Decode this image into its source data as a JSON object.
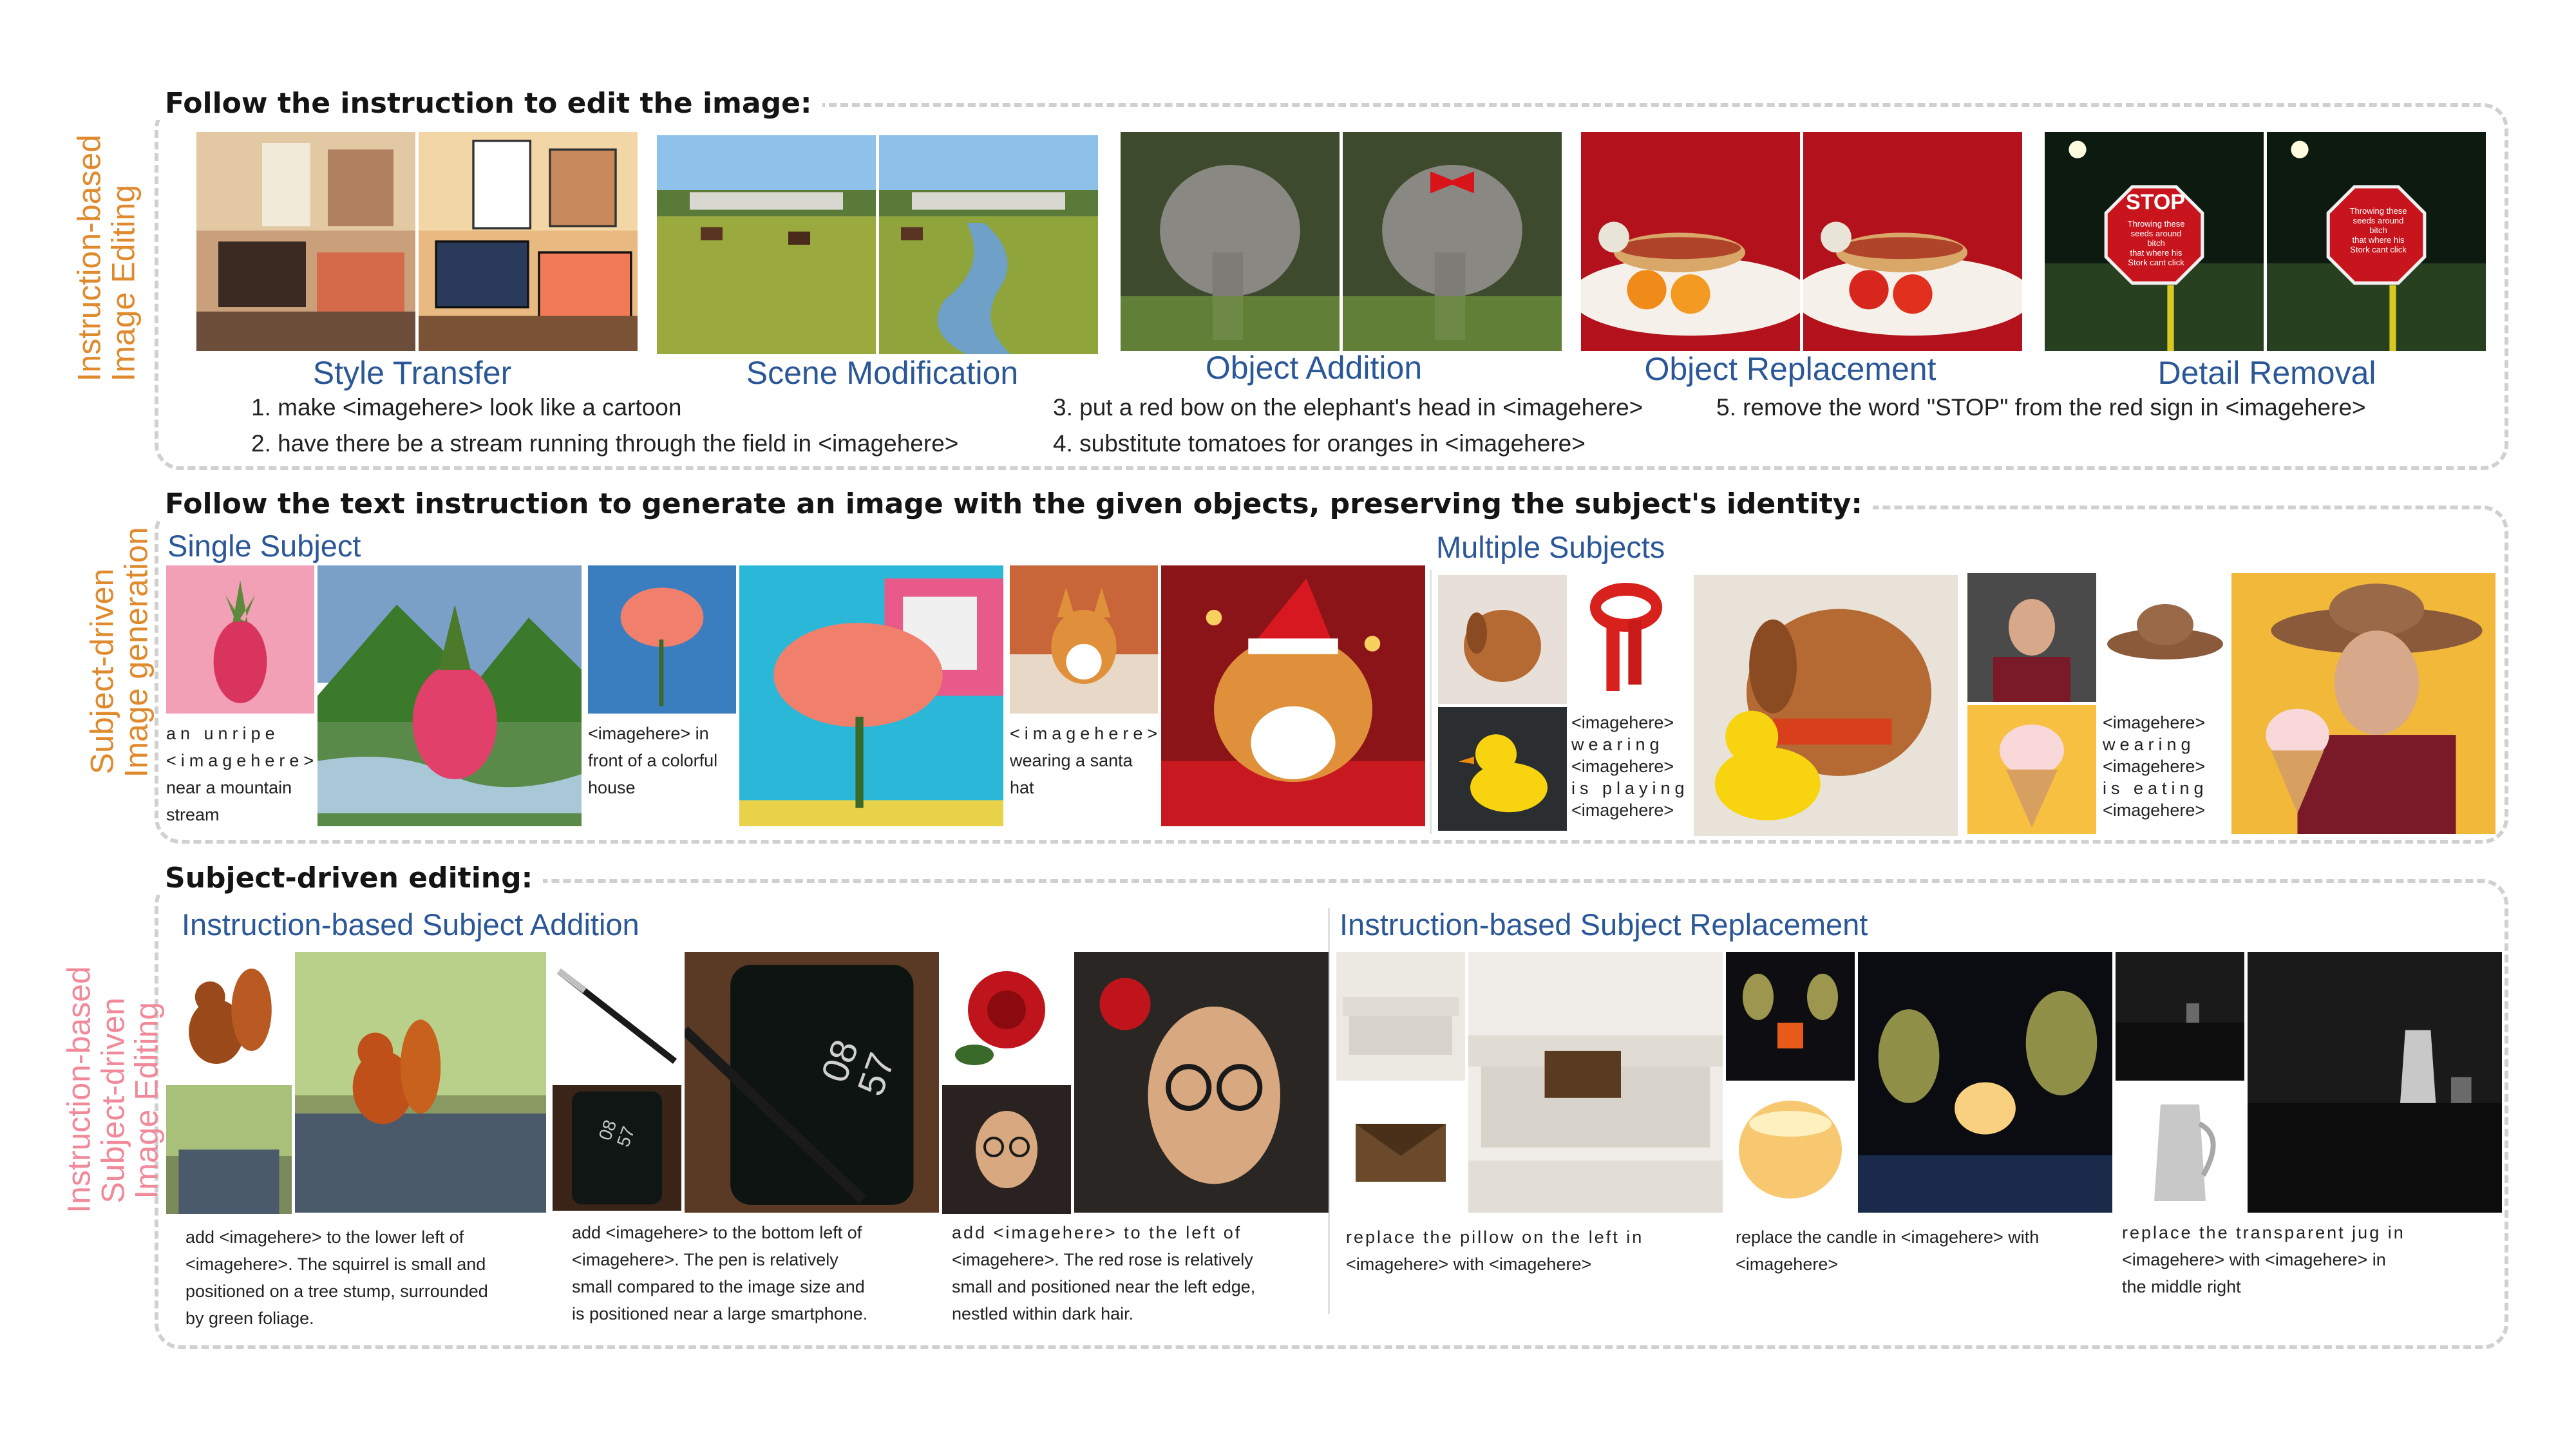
{
  "colors": {
    "orange": "#e08a2e",
    "pink": "#f08a9a",
    "blue": "#2b5797",
    "dash": "#d0d0d0"
  },
  "section1": {
    "heading": "Follow the instruction to edit the image:",
    "side_label": [
      "Instruction-based",
      "Image Editing"
    ],
    "captions": [
      "Style Transfer",
      "Scene Modification",
      "Object Addition",
      "Object Replacement",
      "Detail Removal"
    ],
    "instructions": [
      "1. make <imagehere> look like a cartoon",
      "2. have there be a stream running through the field in <imagehere>",
      "3. put a red bow on the elephant's head in <imagehere>",
      "4. substitute tomatoes for oranges in <imagehere>",
      "5. remove the word \"STOP\" from the red sign in <imagehere>"
    ],
    "images": [
      "bedroom-photo",
      "bedroom-cartoon",
      "field-horses",
      "field-stream",
      "elephant",
      "elephant-red-bow",
      "hotdog-oranges",
      "hotdog-tomatoes",
      "stop-sign",
      "sign-no-stop"
    ],
    "sign_text": {
      "stop": "STOP",
      "lines": [
        "Throwing these",
        "seeds around",
        "bitch",
        "that where his",
        "Stork cant click"
      ]
    }
  },
  "section2": {
    "heading": "Follow the text instruction to generate an image with the given objects, preserving the subject's identity:",
    "side_label": [
      "Subject-driven",
      "Image generation"
    ],
    "single_label": "Single Subject",
    "multiple_label": "Multiple Subjects",
    "captions": {
      "pineapple": [
        "an unripe",
        "<imagehere>",
        "near a mountain",
        "stream"
      ],
      "rose": [
        "<imagehere> in",
        "front of a colorful",
        "house"
      ],
      "corgi": [
        "<imagehere>",
        "wearing a santa",
        "hat"
      ],
      "dog_duck": [
        "<imagehere>",
        "wearing",
        "<imagehere>",
        "is playing",
        "<imagehere>"
      ],
      "man_hat": [
        "<imagehere>",
        "wearing",
        "<imagehere>",
        "is eating",
        "<imagehere>"
      ]
    },
    "images": [
      "pink-pineapple",
      "pineapple-mountain-stream",
      "pink-rose",
      "rose-colorful-house",
      "corgi",
      "corgi-santa-hat",
      "dog",
      "red-scarf",
      "rubber-duck",
      "dog-scarf-duck",
      "man-portrait",
      "cowboy-hat",
      "ice-cream",
      "man-hat-ice-cream"
    ]
  },
  "section3": {
    "heading": "Subject-driven editing:",
    "side_label": [
      "Instruction-based",
      "Subject-driven",
      "Image Editing"
    ],
    "addition_label": "Instruction-based Subject Addition",
    "replacement_label": "Instruction-based Subject Replacement",
    "captions": {
      "squirrel": [
        "add <imagehere> to the lower left of",
        "<imagehere>. The squirrel is small and",
        "positioned on a tree stump, surrounded",
        "by green foliage."
      ],
      "pen": [
        "add <imagehere> to the bottom left of",
        "<imagehere>. The pen is relatively",
        "small compared to the image size and",
        "is positioned near a large smartphone."
      ],
      "rose": [
        "add <imagehere> to the left of",
        "<imagehere>. The red rose is relatively",
        "small and positioned near the left edge,",
        "nestled within dark hair."
      ],
      "pillow": [
        "replace the pillow on the left in",
        "<imagehere> with <imagehere>"
      ],
      "candle": [
        "replace the candle in <imagehere> with",
        "<imagehere>"
      ],
      "jug": [
        "replace the transparent jug in",
        "<imagehere> with <imagehere> in",
        "the middle right"
      ]
    },
    "phone_time": [
      "08",
      "57"
    ],
    "images": [
      "squirrel",
      "forest-stump",
      "squirrel-on-stump",
      "pen",
      "phone",
      "phone-with-pen",
      "red-rose",
      "woman-glasses",
      "woman-with-rose",
      "white-sofa",
      "brown-bag",
      "sofa-with-bag",
      "wine-glasses-candle",
      "glowing-candle",
      "wine-glasses-new-candle",
      "dark-kitchen",
      "metal-pitcher",
      "kitchen-with-pitcher"
    ]
  }
}
